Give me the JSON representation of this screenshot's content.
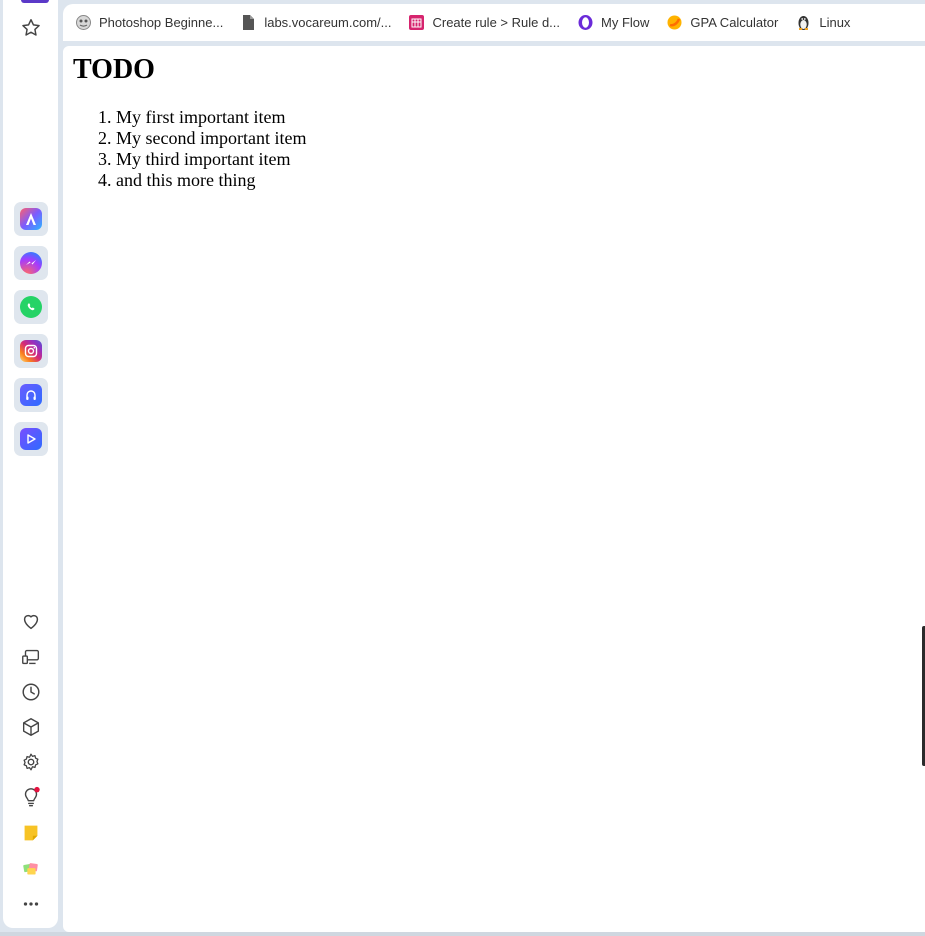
{
  "bookmarks": [
    {
      "label": "Photoshop Beginne...",
      "icon": "photoshop-course-icon"
    },
    {
      "label": "labs.vocareum.com/...",
      "icon": "document-icon"
    },
    {
      "label": "Create rule > Rule d...",
      "icon": "rule-icon"
    },
    {
      "label": "My Flow",
      "icon": "opera-icon"
    },
    {
      "label": "GPA Calculator",
      "icon": "gpa-icon"
    },
    {
      "label": "Linux",
      "icon": "linux-icon"
    }
  ],
  "sidebar": {
    "top": [
      {
        "name": "bookmarks-star-icon"
      }
    ],
    "apps": [
      {
        "name": "aria-app",
        "color": "#7b5cff"
      },
      {
        "name": "messenger-app",
        "color": "#a33bff"
      },
      {
        "name": "whatsapp-app",
        "color": "#25d366"
      },
      {
        "name": "instagram-app",
        "color": "#e1306c"
      },
      {
        "name": "music-player-app",
        "color": "#4a5cff"
      },
      {
        "name": "player-app",
        "color": "#3d5afe"
      }
    ],
    "bottom": [
      "heart-icon",
      "tabs-sync-icon",
      "history-icon",
      "extensions-icon",
      "settings-icon",
      "tips-icon",
      "notes-icon",
      "pinboard-icon",
      "more-icon"
    ]
  },
  "page": {
    "title": "TODO",
    "items": [
      "My first important item",
      "My second important item",
      "My third important item",
      "and this more thing"
    ]
  },
  "colors": {
    "frame": "#dde5ee",
    "accent": "#5b39c8",
    "notification_dot": "#e3123f"
  }
}
